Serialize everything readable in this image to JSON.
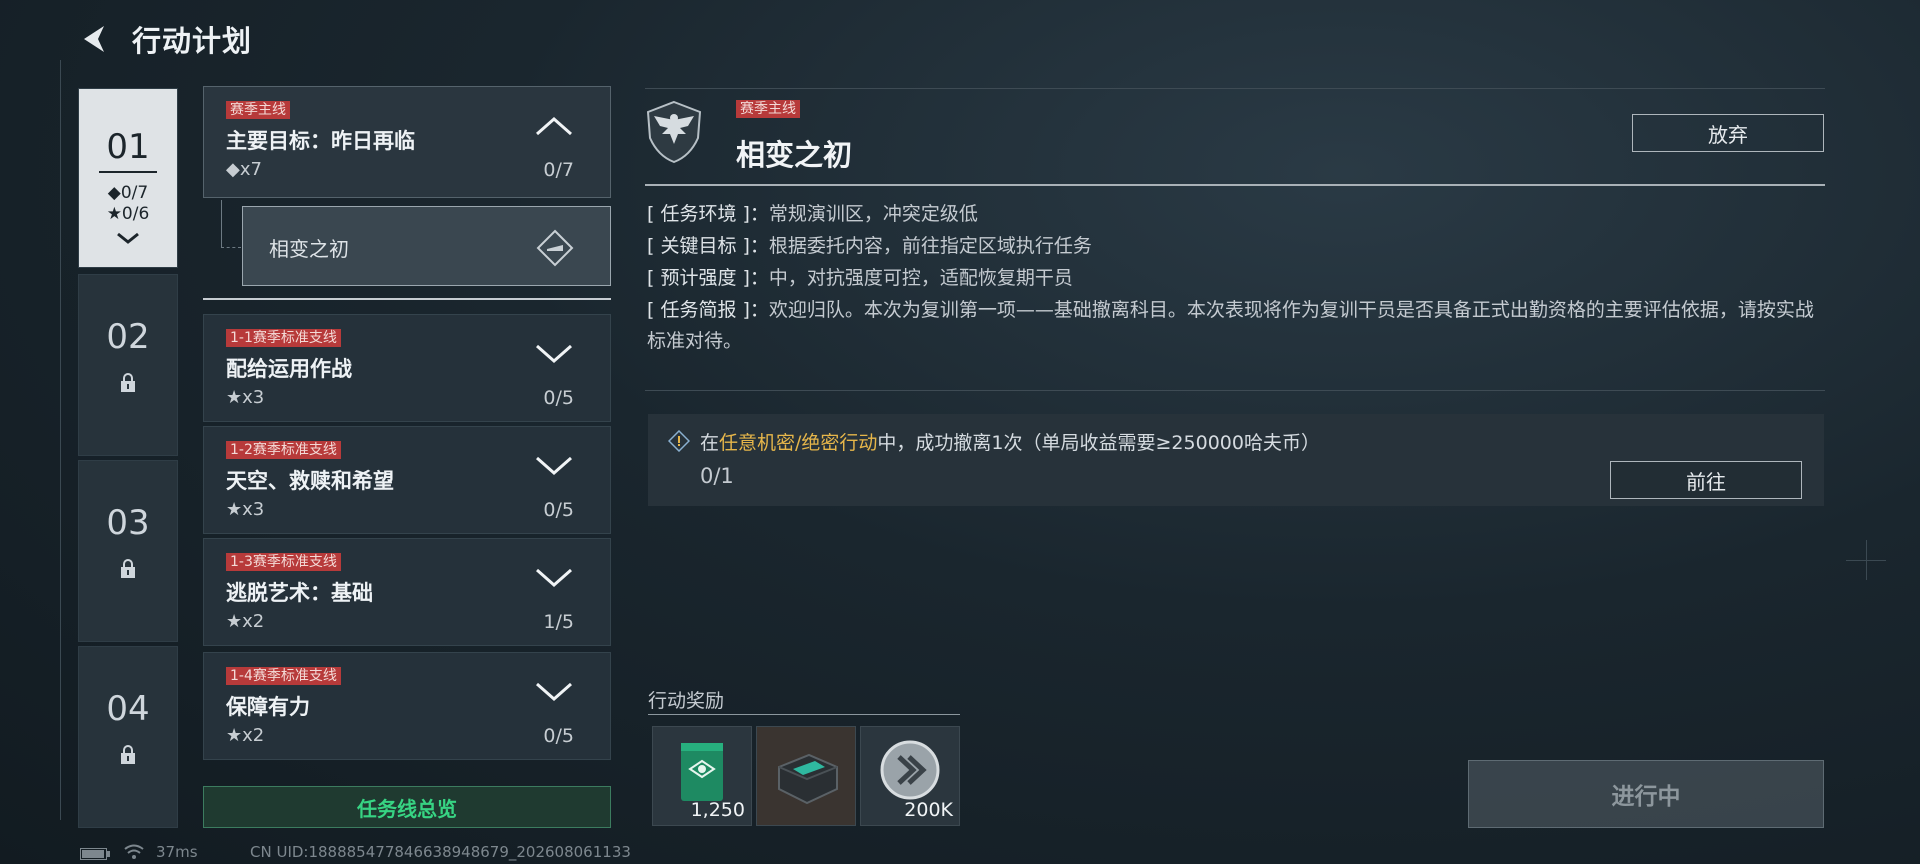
{
  "header": {
    "title": "行动计划"
  },
  "chapters": [
    {
      "num": "01",
      "diamond": "◆0/7",
      "star": "★0/6"
    },
    {
      "num": "02"
    },
    {
      "num": "03"
    },
    {
      "num": "04"
    }
  ],
  "main_mission": {
    "tag": "赛季主线",
    "title": "主要目标：昨日再临",
    "count": "◆x7",
    "progress": "0/7"
  },
  "sub_mission": {
    "label": "相变之初"
  },
  "missions": [
    {
      "tag": "1-1赛季标准支线",
      "title": "配给运用作战",
      "count": "★x3",
      "progress": "0/5"
    },
    {
      "tag": "1-2赛季标准支线",
      "title": "天空、救赎和希望",
      "count": "★x3",
      "progress": "0/5"
    },
    {
      "tag": "1-3赛季标准支线",
      "title": "逃脱艺术：基础",
      "count": "★x2",
      "progress": "1/5"
    },
    {
      "tag": "1-4赛季标准支线",
      "title": "保障有力",
      "count": "★x2",
      "progress": "0/5"
    }
  ],
  "overview_button": "任务线总览",
  "detail": {
    "tag": "赛季主线",
    "title": "相变之初",
    "abandon": "放弃",
    "info": [
      {
        "key": "[ 任务环境 ]：",
        "value": "常规演训区，冲突定级低"
      },
      {
        "key": "[ 关键目标 ]：",
        "value": "根据委托内容，前往指定区域执行任务"
      },
      {
        "key": "[ 预计强度 ]：",
        "value": "中，对抗强度可控，适配恢复期干员"
      },
      {
        "key": "[ 任务简报 ]：",
        "value": "欢迎归队。本次为复训第一项——基础撤离科目。本次表现将作为复训干员是否具备正式出勤资格的主要评估依据，请按实战标准对待。"
      }
    ],
    "task": {
      "prefix": "在",
      "highlight": "任意机密/绝密行动",
      "suffix": "中，成功撤离1次（单局收益需要≥250000哈夫币）",
      "progress": "0/1",
      "goto": "前往"
    },
    "reward_label": "行动奖励",
    "rewards": [
      {
        "icon": "green-card-icon",
        "qty": "1,250"
      },
      {
        "icon": "equipment-box-icon",
        "qty": ""
      },
      {
        "icon": "silver-coin-icon",
        "qty": "200K"
      }
    ],
    "status_button": "进行中"
  },
  "footer": {
    "ping": "37ms",
    "uid": "CN UID:18888547784663894867​9_202608061133"
  },
  "colors": {
    "accent_red": "#b73a3a",
    "accent_green": "#37d483",
    "highlight_gold": "#e6b64a"
  }
}
